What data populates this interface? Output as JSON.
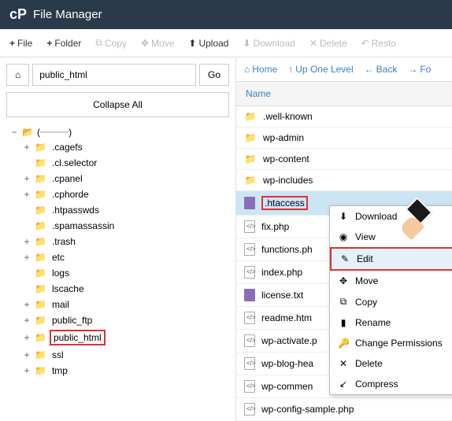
{
  "header": {
    "logo": "cP",
    "title": "File Manager"
  },
  "toolbar": {
    "file": "File",
    "folder": "Folder",
    "copy": "Copy",
    "move": "Move",
    "upload": "Upload",
    "download": "Download",
    "delete": "Delete",
    "restore": "Resto"
  },
  "left": {
    "path": "public_html",
    "go": "Go",
    "collapse": "Collapse All",
    "root": "(",
    "root_suffix": ")",
    "items": [
      {
        "label": ".cagefs",
        "toggle": "+"
      },
      {
        "label": ".cl.selector",
        "toggle": ""
      },
      {
        "label": ".cpanel",
        "toggle": "+"
      },
      {
        "label": ".cphorde",
        "toggle": "+"
      },
      {
        "label": ".htpasswds",
        "toggle": ""
      },
      {
        "label": ".spamassassin",
        "toggle": ""
      },
      {
        "label": ".trash",
        "toggle": "+"
      },
      {
        "label": "etc",
        "toggle": "+"
      },
      {
        "label": "logs",
        "toggle": ""
      },
      {
        "label": "lscache",
        "toggle": ""
      },
      {
        "label": "mail",
        "toggle": "+"
      },
      {
        "label": "public_ftp",
        "toggle": "+"
      },
      {
        "label": "public_html",
        "toggle": "+",
        "highlight": true
      },
      {
        "label": "ssl",
        "toggle": "+"
      },
      {
        "label": "tmp",
        "toggle": "+"
      }
    ]
  },
  "right": {
    "nav": {
      "home": "Home",
      "up": "Up One Level",
      "back": "Back",
      "forward": "Fo"
    },
    "col": "Name",
    "files": [
      {
        "name": ".well-known",
        "type": "folder"
      },
      {
        "name": "wp-admin",
        "type": "folder"
      },
      {
        "name": "wp-content",
        "type": "folder"
      },
      {
        "name": "wp-includes",
        "type": "folder"
      },
      {
        "name": ".htaccess",
        "type": "file-purple",
        "selected": true
      },
      {
        "name": "fix.php",
        "type": "file"
      },
      {
        "name": "functions.ph",
        "type": "file"
      },
      {
        "name": "index.php",
        "type": "file"
      },
      {
        "name": "license.txt",
        "type": "file-purple"
      },
      {
        "name": "readme.htm",
        "type": "file"
      },
      {
        "name": "wp-activate.p",
        "type": "file"
      },
      {
        "name": "wp-blog-hea",
        "type": "file"
      },
      {
        "name": "wp-commen",
        "type": "file"
      },
      {
        "name": "wp-config-sample.php",
        "type": "file"
      }
    ]
  },
  "context": {
    "download": "Download",
    "view": "View",
    "edit": "Edit",
    "move": "Move",
    "copy": "Copy",
    "rename": "Rename",
    "perms": "Change Permissions",
    "delete": "Delete",
    "compress": "Compress"
  }
}
